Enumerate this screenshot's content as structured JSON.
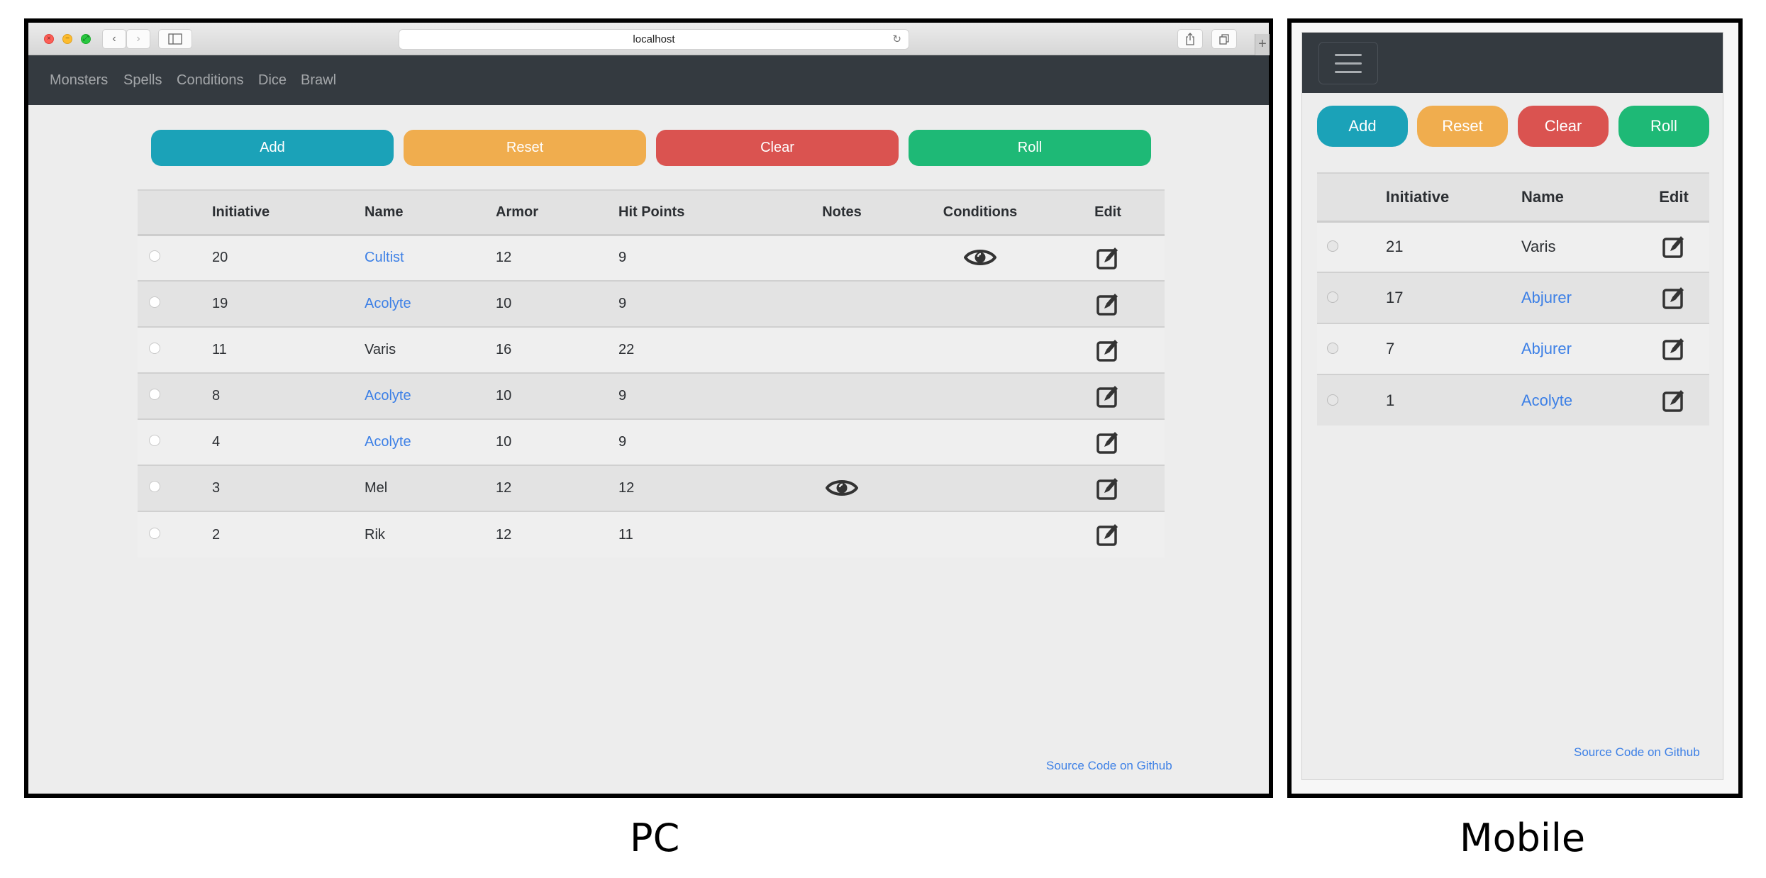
{
  "pc": {
    "browser": {
      "url": "localhost",
      "reload_icon": "reload-icon",
      "back_icon": "chevron-left-icon",
      "forward_icon": "chevron-right-icon",
      "sidebar_icon": "sidebar-icon",
      "share_icon": "share-icon",
      "tabs_icon": "tabs-icon",
      "new_tab_icon": "plus-icon"
    },
    "navbar": {
      "items": [
        {
          "label": "Monsters"
        },
        {
          "label": "Spells"
        },
        {
          "label": "Conditions"
        },
        {
          "label": "Dice"
        },
        {
          "label": "Brawl"
        }
      ]
    },
    "buttons": {
      "add": "Add",
      "reset": "Reset",
      "clear": "Clear",
      "roll": "Roll"
    },
    "table": {
      "headers": [
        "",
        "Initiative",
        "Name",
        "Armor",
        "Hit Points",
        "Notes",
        "Conditions",
        "Edit"
      ],
      "rows": [
        {
          "initiative": "20",
          "name": "Cultist",
          "is_link": true,
          "armor": "12",
          "hit_points": "9",
          "notes_icon": false,
          "conditions_icon": true
        },
        {
          "initiative": "19",
          "name": "Acolyte",
          "is_link": true,
          "armor": "10",
          "hit_points": "9",
          "notes_icon": false,
          "conditions_icon": false
        },
        {
          "initiative": "11",
          "name": "Varis",
          "is_link": false,
          "armor": "16",
          "hit_points": "22",
          "notes_icon": false,
          "conditions_icon": false
        },
        {
          "initiative": "8",
          "name": "Acolyte",
          "is_link": true,
          "armor": "10",
          "hit_points": "9",
          "notes_icon": false,
          "conditions_icon": false
        },
        {
          "initiative": "4",
          "name": "Acolyte",
          "is_link": true,
          "armor": "10",
          "hit_points": "9",
          "notes_icon": false,
          "conditions_icon": false
        },
        {
          "initiative": "3",
          "name": "Mel",
          "is_link": false,
          "armor": "12",
          "hit_points": "12",
          "notes_icon": true,
          "conditions_icon": false
        },
        {
          "initiative": "2",
          "name": "Rik",
          "is_link": false,
          "armor": "12",
          "hit_points": "11",
          "notes_icon": false,
          "conditions_icon": false
        }
      ]
    },
    "footer_link": "Source Code on Github"
  },
  "mobile": {
    "menu_icon": "hamburger-icon",
    "buttons": {
      "add": "Add",
      "reset": "Reset",
      "clear": "Clear",
      "roll": "Roll"
    },
    "table": {
      "headers": [
        "",
        "Initiative",
        "Name",
        "Edit"
      ],
      "rows": [
        {
          "initiative": "21",
          "name": "Varis",
          "is_link": false
        },
        {
          "initiative": "17",
          "name": "Abjurer",
          "is_link": true
        },
        {
          "initiative": "7",
          "name": "Abjurer",
          "is_link": true
        },
        {
          "initiative": "1",
          "name": "Acolyte",
          "is_link": true
        }
      ]
    },
    "footer_link": "Source Code on Github"
  },
  "captions": {
    "pc": "PC",
    "mobile": "Mobile"
  },
  "colors": {
    "navbar": "#343a40",
    "add": "#1ba2b8",
    "reset": "#f0ad4e",
    "clear": "#da5350",
    "roll": "#1eb976",
    "link": "#3d80e6"
  }
}
